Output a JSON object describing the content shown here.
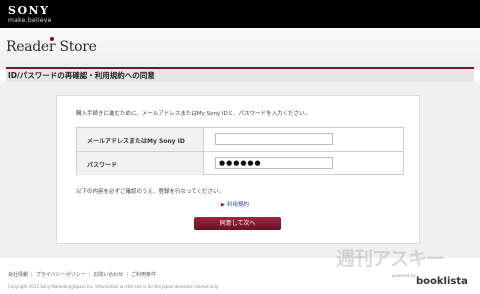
{
  "brand": {
    "sony_logo": "SONY",
    "sony_tagline": "make.believe",
    "store_logo": "Reader Store"
  },
  "page": {
    "title": "ID/パスワードの再確認・利用規約への同意"
  },
  "form": {
    "intro": "購入手続きに進むために、メールアドレスまたはMy Sony IDと、パスワードを入力ください。",
    "email_label": "メールアドレスまたはMy Sony ID",
    "email_value": "",
    "password_label": "パスワード",
    "password_value": "●●●●●●",
    "notice": "以下の内容を必ずご確認のうえ、登録を行なってください。",
    "terms_link": "利用規約",
    "submit_label": "同意して次へ"
  },
  "footer": {
    "links": [
      "会社情報",
      "プライバシーポリシー",
      "お問い合わせ",
      "ご利用条件"
    ],
    "copyright": "Copyright 2012 Sony Marketing(Japan) Inc.  Information on this site is for the Japan domestic market only."
  },
  "overlay": {
    "watermark": "週刊アスキー",
    "powered_by": "powered by",
    "booklista": "booklista"
  }
}
